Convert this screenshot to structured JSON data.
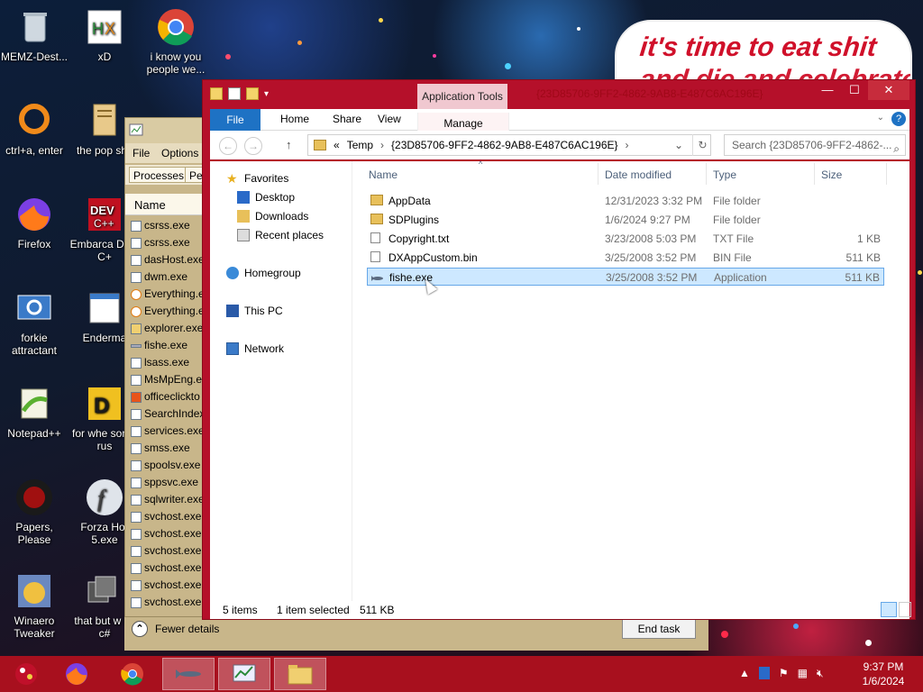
{
  "wallpaper_text": {
    "line1": "it's time to eat shit",
    "line2": "and die and celebrate"
  },
  "desktop_icons": [
    {
      "label": "MEMZ-Dest...",
      "icon": "recycle-bin-icon"
    },
    {
      "label": "xD",
      "icon": "hxd-icon"
    },
    {
      "label": "i know you people we...",
      "icon": "chrome-icon"
    },
    {
      "label": "ctrl+a, enter",
      "icon": "ring-icon"
    },
    {
      "label": "the pop shit",
      "icon": "folder-notes-icon"
    },
    {
      "label": "Firefox",
      "icon": "firefox-icon"
    },
    {
      "label": "Embarca Dev-C+",
      "icon": "devcpp-icon"
    },
    {
      "label": "forkie attractant",
      "icon": "gear-monitor-icon"
    },
    {
      "label": "Enderma",
      "icon": "app-window-icon"
    },
    {
      "label": "Notepad++",
      "icon": "notepadpp-icon"
    },
    {
      "label": "for whe some rus",
      "icon": "dev-app-icon"
    },
    {
      "label": "Papers, Please",
      "icon": "papers-please-icon"
    },
    {
      "label": "Forza Hor 5.exe",
      "icon": "flash-icon"
    },
    {
      "label": "Winaero Tweaker",
      "icon": "winaero-icon"
    },
    {
      "label": "that but w its c#",
      "icon": "stack-windows-icon"
    }
  ],
  "task_manager": {
    "menu": [
      "File",
      "Options"
    ],
    "tabs": [
      "Processes",
      "Pe"
    ],
    "column": "Name",
    "processes": [
      "csrss.exe",
      "csrss.exe",
      "dasHost.exe",
      "dwm.exe",
      "Everything.e",
      "Everything.e",
      "explorer.exe",
      "fishe.exe",
      "lsass.exe",
      "MsMpEng.e",
      "officeclickto",
      "SearchIndex",
      "services.exe",
      "smss.exe",
      "spoolsv.exe",
      "sppsvc.exe",
      "sqlwriter.exe",
      "svchost.exe",
      "svchost.exe",
      "svchost.exe",
      "svchost.exe",
      "svchost.exe",
      "svchost.exe"
    ],
    "fewer_details": "Fewer details",
    "end_task": "End task"
  },
  "explorer": {
    "contextual_tab": "Application Tools",
    "title": "{23D85706-9FF2-4862-9AB8-E487C6AC196E}",
    "ribbon": {
      "file": "File",
      "home": "Home",
      "share": "Share",
      "view": "View",
      "manage": "Manage"
    },
    "address": {
      "prefix": "«",
      "crumb1": "Temp",
      "crumb2": "{23D85706-9FF2-4862-9AB8-E487C6AC196E}"
    },
    "search_placeholder": "Search {23D85706-9FF2-4862-...",
    "nav": {
      "favorites": "Favorites",
      "desktop": "Desktop",
      "downloads": "Downloads",
      "recent": "Recent places",
      "homegroup": "Homegroup",
      "thispc": "This PC",
      "network": "Network"
    },
    "columns": {
      "name": "Name",
      "date": "Date modified",
      "type": "Type",
      "size": "Size"
    },
    "files": [
      {
        "name": "AppData",
        "date": "12/31/2023 3:32 PM",
        "type": "File folder",
        "size": ""
      },
      {
        "name": "SDPlugins",
        "date": "1/6/2024 9:27 PM",
        "type": "File folder",
        "size": ""
      },
      {
        "name": "Copyright.txt",
        "date": "3/23/2008 5:03 PM",
        "type": "TXT File",
        "size": "1 KB"
      },
      {
        "name": "DXAppCustom.bin",
        "date": "3/25/2008 3:52 PM",
        "type": "BIN File",
        "size": "511 KB"
      },
      {
        "name": "fishe.exe",
        "date": "3/25/2008 3:52 PM",
        "type": "Application",
        "size": "511 KB"
      }
    ],
    "status": {
      "items": "5 items",
      "selected": "1 item selected",
      "size": "511 KB"
    }
  },
  "taskbar": {
    "clock_time": "9:37 PM",
    "clock_date": "1/6/2024"
  },
  "colors": {
    "accent_red": "#b5102a",
    "ribbon_blue": "#1e72c4",
    "selection": "#cde8ff"
  }
}
